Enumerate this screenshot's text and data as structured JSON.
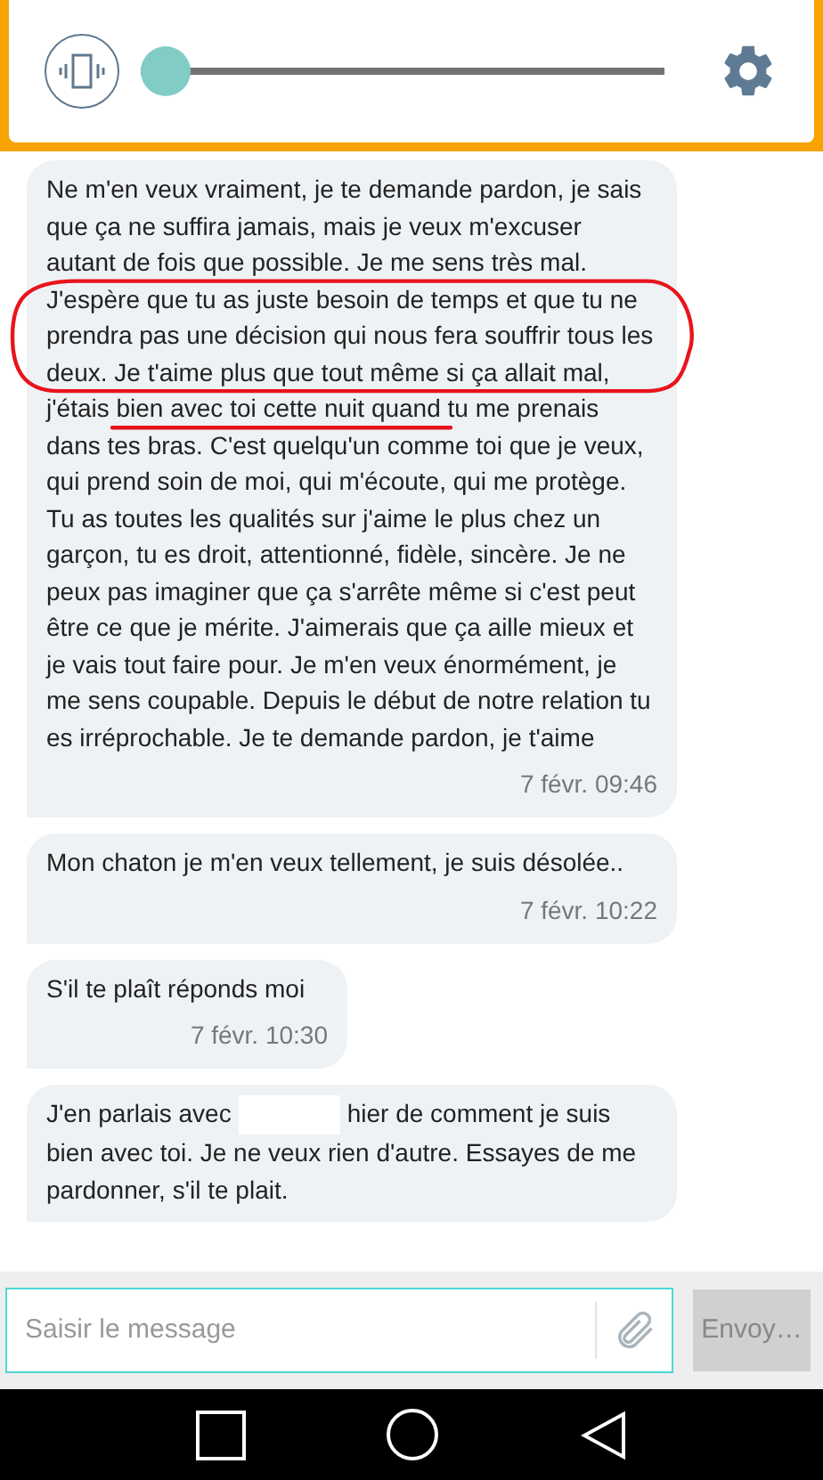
{
  "toolbar": {
    "slider": {
      "level": 0
    }
  },
  "messages": [
    {
      "kind": "plain",
      "text": "Ne m'en veux vraiment, je te demande pardon, je sais que ça ne suffira jamais, mais je veux m'excuser autant de fois que possible. Je me sens très mal. J'espère que tu as juste besoin de temps et que tu ne prendra pas une décision qui nous fera souffrir tous les deux. Je t'aime plus que tout même si ça allait mal, j'étais bien avec toi cette nuit quand tu me prenais dans tes bras. C'est quelqu'un comme toi que je veux, qui prend soin de moi, qui m'écoute, qui me protège. Tu as toutes les qualités sur j'aime le plus chez un garçon, tu es droit, attentionné, fidèle, sincère. Je ne peux pas imaginer que ça s'arrête même si c'est peut être ce que je mérite. J'aimerais que ça aille mieux et je vais tout faire pour. Je m'en veux énormément, je me sens coupable. Depuis le début de notre relation tu es irréprochable. Je te demande pardon, je t'aime",
      "time": "7 févr. 09:46",
      "scribbled": true
    },
    {
      "kind": "plain",
      "text": "Mon chaton je m'en veux tellement, je suis désolée..",
      "time": "7 févr. 10:22",
      "scribbled": false
    },
    {
      "kind": "plain",
      "text": "S'il te plaît réponds moi",
      "time": "7 févr. 10:30",
      "scribbled": false
    },
    {
      "kind": "redacted",
      "before": "J'en parlais avec",
      "after": "hier de comment je suis bien avec toi. Je ne veux rien d'autre. Essayes de me pardonner, s'il te plait.",
      "scribbled": false
    }
  ],
  "composer": {
    "placeholder": "Saisir le message",
    "send": "Envoy…"
  }
}
